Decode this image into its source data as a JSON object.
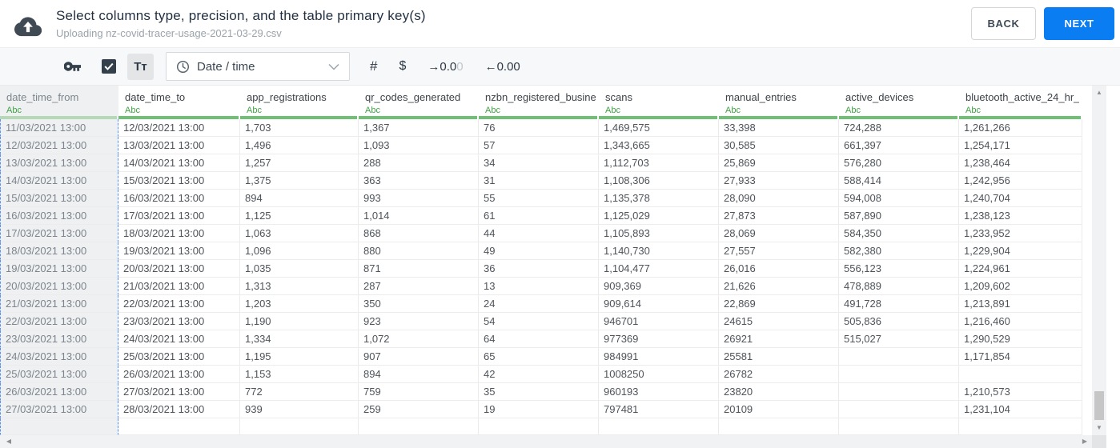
{
  "header": {
    "title": "Select columns type, precision, and the table primary key(s)",
    "subtitle": "Uploading nz-covid-tracer-usage-2021-03-29.csv",
    "back_label": "BACK",
    "next_label": "NEXT"
  },
  "toolbar": {
    "primary_key_icon": "key-icon",
    "checkbox_checked": true,
    "text_type_label": "Tᴛ",
    "type_select": {
      "value": "Date / time",
      "icon": "clock-icon"
    },
    "number_label": "#",
    "currency_label": "$",
    "decimal_increase": {
      "text": "→0.0",
      "faded": "0"
    },
    "decimal_decrease": "←0.00"
  },
  "table": {
    "type_tag": "Abc",
    "columns": [
      {
        "name": "date_time_from",
        "type": "Abc",
        "selected": true
      },
      {
        "name": "date_time_to",
        "type": "Abc",
        "selected": false
      },
      {
        "name": "app_registrations",
        "type": "Abc",
        "selected": false
      },
      {
        "name": "qr_codes_generated",
        "type": "Abc",
        "selected": false
      },
      {
        "name": "nzbn_registered_busine",
        "type": "Abc",
        "selected": false
      },
      {
        "name": "scans",
        "type": "Abc",
        "selected": false
      },
      {
        "name": "manual_entries",
        "type": "Abc",
        "selected": false
      },
      {
        "name": "active_devices",
        "type": "Abc",
        "selected": false
      },
      {
        "name": "bluetooth_active_24_hr_",
        "type": "Abc",
        "selected": false
      }
    ],
    "rows": [
      [
        "11/03/2021 13:00",
        "12/03/2021 13:00",
        "1,703",
        "1,367",
        "76",
        "1,469,575",
        "33,398",
        "724,288",
        "1,261,266"
      ],
      [
        "12/03/2021 13:00",
        "13/03/2021 13:00",
        "1,496",
        "1,093",
        "57",
        "1,343,665",
        "30,585",
        "661,397",
        "1,254,171"
      ],
      [
        "13/03/2021 13:00",
        "14/03/2021 13:00",
        "1,257",
        "288",
        "34",
        "1,112,703",
        "25,869",
        "576,280",
        "1,238,464"
      ],
      [
        "14/03/2021 13:00",
        "15/03/2021 13:00",
        "1,375",
        "363",
        "31",
        "1,108,306",
        "27,933",
        "588,414",
        "1,242,956"
      ],
      [
        "15/03/2021 13:00",
        "16/03/2021 13:00",
        "894",
        "993",
        "55",
        "1,135,378",
        "28,090",
        "594,008",
        "1,240,704"
      ],
      [
        "16/03/2021 13:00",
        "17/03/2021 13:00",
        "1,125",
        "1,014",
        "61",
        "1,125,029",
        "27,873",
        "587,890",
        "1,238,123"
      ],
      [
        "17/03/2021 13:00",
        "18/03/2021 13:00",
        "1,063",
        "868",
        "44",
        "1,105,893",
        "28,069",
        "584,350",
        "1,233,952"
      ],
      [
        "18/03/2021 13:00",
        "19/03/2021 13:00",
        "1,096",
        "880",
        "49",
        "1,140,730",
        "27,557",
        "582,380",
        "1,229,904"
      ],
      [
        "19/03/2021 13:00",
        "20/03/2021 13:00",
        "1,035",
        "871",
        "36",
        "1,104,477",
        "26,016",
        "556,123",
        "1,224,961"
      ],
      [
        "20/03/2021 13:00",
        "21/03/2021 13:00",
        "1,313",
        "287",
        "13",
        "909,369",
        "21,626",
        "478,889",
        "1,209,602"
      ],
      [
        "21/03/2021 13:00",
        "22/03/2021 13:00",
        "1,203",
        "350",
        "24",
        "909,614",
        "22,869",
        "491,728",
        "1,213,891"
      ],
      [
        "22/03/2021 13:00",
        "23/03/2021 13:00",
        "1,190",
        "923",
        "54",
        "946701",
        "24615",
        "505,836",
        "1,216,460"
      ],
      [
        "23/03/2021 13:00",
        "24/03/2021 13:00",
        "1,334",
        "1,072",
        "64",
        "977369",
        "26921",
        "515,027",
        "1,290,529"
      ],
      [
        "24/03/2021 13:00",
        "25/03/2021 13:00",
        "1,195",
        "907",
        "65",
        "984991",
        "25581",
        "",
        "1,171,854"
      ],
      [
        "25/03/2021 13:00",
        "26/03/2021 13:00",
        "1,153",
        "894",
        "42",
        "1008250",
        "26782",
        "",
        ""
      ],
      [
        "26/03/2021 13:00",
        "27/03/2021 13:00",
        "772",
        "759",
        "35",
        "960193",
        "23820",
        "",
        "1,210,573"
      ],
      [
        "27/03/2021 13:00",
        "28/03/2021 13:00",
        "939",
        "259",
        "19",
        "797481",
        "20109",
        "",
        "1,231,104"
      ]
    ]
  },
  "colors": {
    "accent_blue": "#0b7df2",
    "type_green": "#3fa344",
    "header_underline_green": "#6fbf74",
    "selected_underline_green": "#b5d9b7",
    "selected_column_border": "#5b92f2",
    "dark_icon": "#333f4b"
  }
}
